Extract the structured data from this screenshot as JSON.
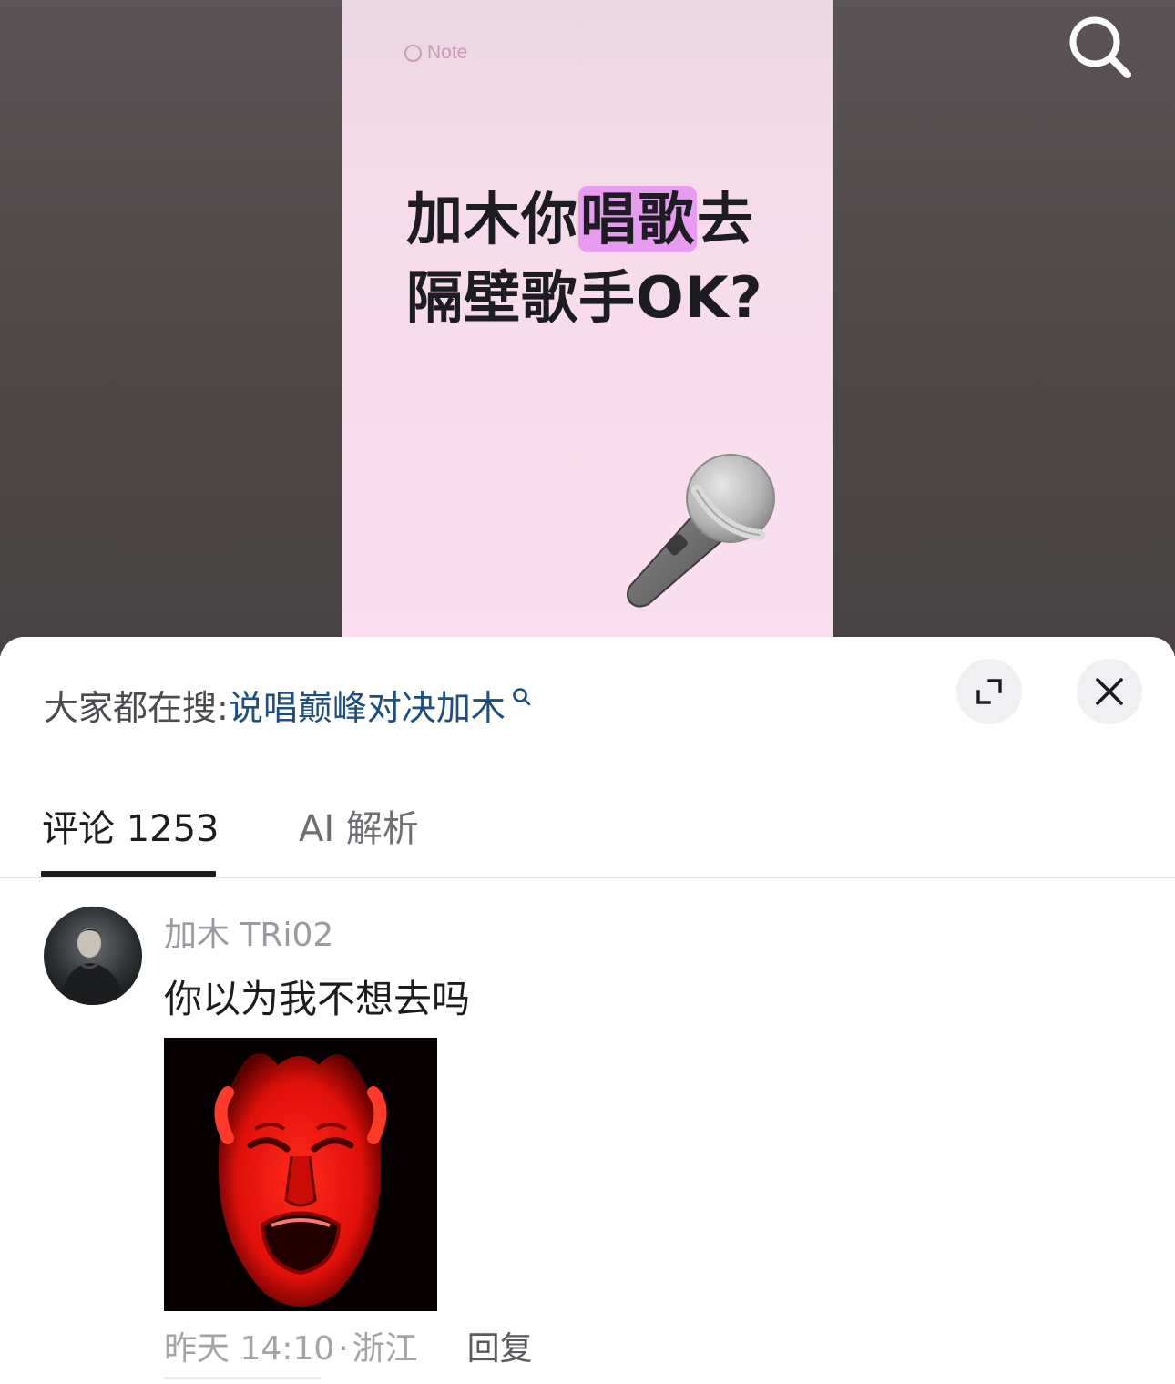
{
  "video": {
    "note_tag": "Note",
    "title_line1_pre": "加木你",
    "title_line1_highlight": "唱歌",
    "title_line1_post": "去",
    "title_line2": "隔壁歌手OK?",
    "highlight_color": "#e79cf0",
    "icons": [
      "search-icon",
      "microphone-icon"
    ]
  },
  "sheet": {
    "trending": {
      "prefix": "大家都在搜:",
      "query": "说唱巅峰对决加木",
      "link_color": "#1f4f80"
    },
    "actions": [
      "expand-icon",
      "close-icon"
    ],
    "tabs": [
      {
        "label": "评论 1253",
        "active": true
      },
      {
        "label": "AI 解析",
        "active": false
      }
    ],
    "comments": [
      {
        "username": "加木 TRi02",
        "text": "你以为我不想去吗",
        "time": "昨天 14:10",
        "separator": "·",
        "location": "浙江",
        "reply_label": "回复"
      }
    ]
  }
}
